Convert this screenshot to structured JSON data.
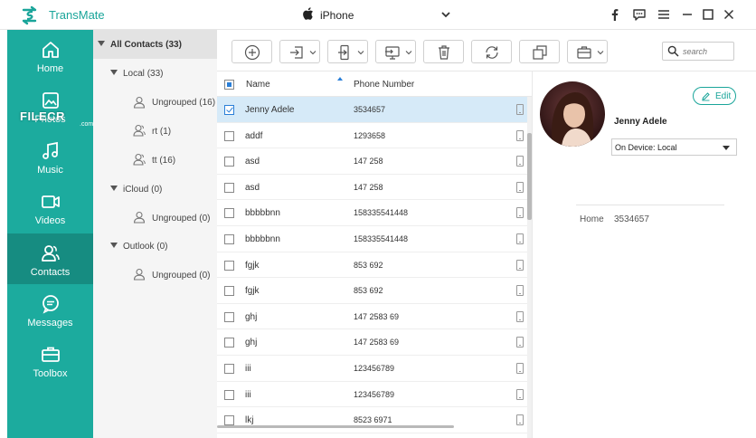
{
  "app": {
    "title": "TransMate"
  },
  "device": {
    "name": "iPhone"
  },
  "watermark": {
    "text": "FILECR",
    "sub": ".com"
  },
  "sidebar": {
    "items": [
      {
        "label": "Home"
      },
      {
        "label": "Photos"
      },
      {
        "label": "Music"
      },
      {
        "label": "Videos"
      },
      {
        "label": "Contacts",
        "active": true
      },
      {
        "label": "Messages"
      },
      {
        "label": "Toolbox"
      }
    ]
  },
  "tree": {
    "all": {
      "label": "All Contacts",
      "count": "(33)"
    },
    "local": {
      "label": "Local",
      "count": "(33)"
    },
    "local_ungrouped": {
      "label": "Ungrouped",
      "count": "(16)"
    },
    "rt": {
      "label": "rt",
      "count": "(1)"
    },
    "tt": {
      "label": "tt",
      "count": "(16)"
    },
    "icloud": {
      "label": "iCloud",
      "count": "(0)"
    },
    "icloud_ungrouped": {
      "label": "Ungrouped",
      "count": "(0)"
    },
    "outlook": {
      "label": "Outlook",
      "count": "(0)"
    },
    "outlook_ungrouped": {
      "label": "Ungrouped",
      "count": "(0)"
    }
  },
  "search": {
    "placeholder": "search"
  },
  "list": {
    "headers": {
      "name": "Name",
      "phone": "Phone Number"
    },
    "rows": [
      {
        "name": "Jenny Adele",
        "phone": "3534657",
        "selected": true
      },
      {
        "name": "addf",
        "phone": "1293658"
      },
      {
        "name": "asd",
        "phone": "147 258"
      },
      {
        "name": "asd",
        "phone": "147 258"
      },
      {
        "name": "bbbbbnn",
        "phone": "158335541448"
      },
      {
        "name": "bbbbbnn",
        "phone": "158335541448"
      },
      {
        "name": "fgjk",
        "phone": "853 692"
      },
      {
        "name": "fgjk",
        "phone": "853 692"
      },
      {
        "name": "ghj",
        "phone": "147 2583 69"
      },
      {
        "name": "ghj",
        "phone": "147 2583 69"
      },
      {
        "name": "iii",
        "phone": "123456789"
      },
      {
        "name": "iii",
        "phone": "123456789"
      },
      {
        "name": "lkj",
        "phone": "8523 6971"
      }
    ]
  },
  "detail": {
    "edit_label": "Edit",
    "name": "Jenny Adele",
    "location": "On Device: Local",
    "field_label": "Home",
    "field_value": "3534657"
  },
  "colors": {
    "accent": "#1cab9e",
    "accent_dark": "#168c81",
    "select_blue": "#2a7fd8"
  }
}
